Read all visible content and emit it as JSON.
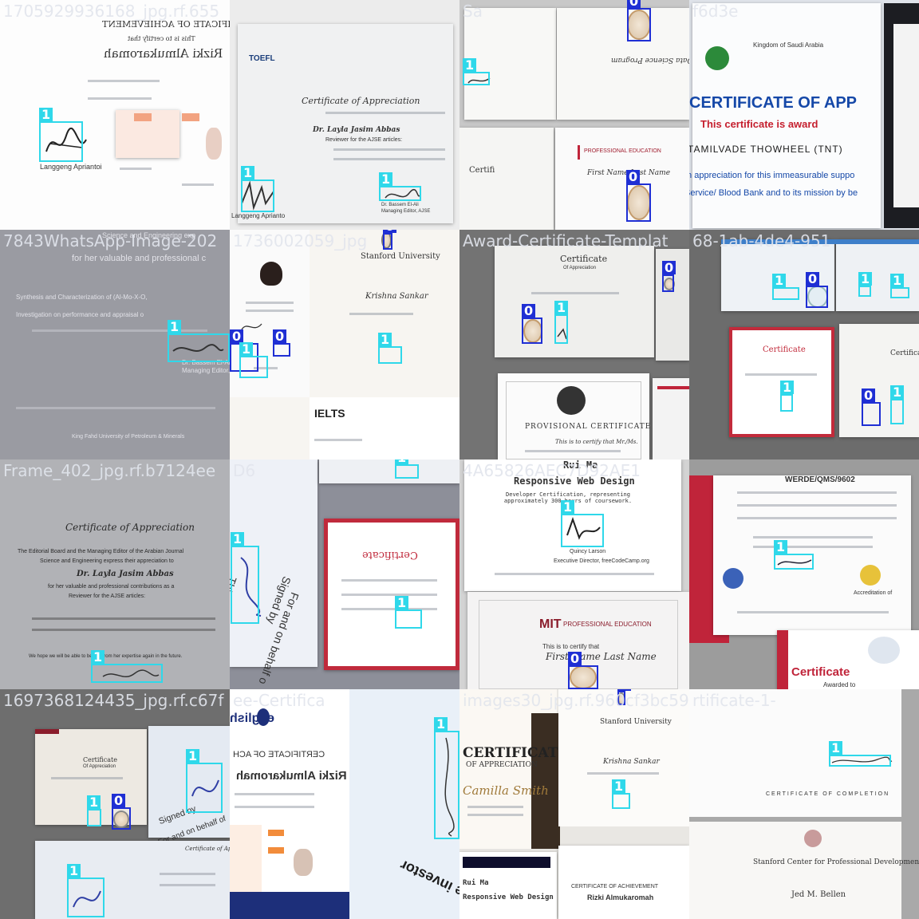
{
  "tiles": [
    {
      "label": "1705929936168_jpg.rf.655",
      "texts": {
        "t1": "CERTIFICATE OF ACHIEVEMENT",
        "t2": "This is to certify that",
        "t3": "Rizki Almukaromah",
        "t4": "Langgeng Apriantoi"
      }
    },
    {
      "label": "",
      "texts": {
        "t1": "Certificate of Appreciation",
        "t2": "Dr. Layla Jasim Abbas",
        "t3": "Reviewer for the AJSE articles:",
        "t4": "Langgeng Aprianto",
        "t5": "TOEFL",
        "t6": "Dr. Bassem El-Ali",
        "t7": "Managing Editor, AJSE"
      }
    },
    {
      "label": "Sa",
      "texts": {
        "t1": "PROFESSIONAL EDUCATION",
        "t2": "First Name Last Name",
        "t3": "Certifi"
      }
    },
    {
      "label": "f6d3e",
      "texts": {
        "t1": "Kingdom of Saudi Arabia",
        "t2": "CERTIFICATE OF APP",
        "t3": "This certificate is award",
        "t4": "TAMILVADE THOWHEEL (TNT)",
        "t5": "In appreciation for this immeasurable suppo",
        "t6": "Service/ Blood Bank and to its mission by be"
      }
    },
    {
      "label": "7843WhatsApp-Image-202",
      "texts": {
        "t1": "Science and Engineering exp",
        "t2": "for her valuable and professional c",
        "t3": "Synthesis and Characterization of (Al-Mo-X-O,",
        "t4": "Investigation on performance and appraisal o",
        "t5": "Dr. Bassem El-Al",
        "t6": "Managing Editor, A",
        "t7": "King Fahd University of Petroleum & Minerals"
      }
    },
    {
      "label": "1736002059_jpg",
      "texts": {
        "t1": "Stanford University",
        "t2": "Krishna Sankar",
        "t3": "IELTS"
      }
    },
    {
      "label": "Award-Certificate-Templat",
      "texts": {
        "t1": "Certificate",
        "t2": "Of Appreciation",
        "t3": "PROVISIONAL CERTIFICATE",
        "t4": "This is to certify that Mr./Ms."
      }
    },
    {
      "label": "68-1ab-4de4-951",
      "texts": {
        "t1": "Certificate",
        "t2": "Certificate"
      }
    },
    {
      "label": "Frame_402_jpg.rf.b7124ee",
      "texts": {
        "t1": "Certificate of Appreciation",
        "t2": "The Editorial Board and the Managing Editor of the Arabian Journal",
        "t3": "Science and Engineering express their appreciation to",
        "t4": "Dr. Layla Jasim Abbas",
        "t5": "for her valuable and professional contributions as a",
        "t6": "Reviewer for the AJSE articles:",
        "t7": "We hope we will be able to benefit from her expertise again in the future."
      }
    },
    {
      "label": "D6",
      "texts": {
        "t1": "Certificate",
        "t2": "This agreement",
        "t3": "Signed by",
        "t4": "For and on behalf o"
      }
    },
    {
      "label": "4A65826AEC7D92AE1",
      "texts": {
        "t1": "Responsive Web Design",
        "t2": "Developer Certification, representing approximately 300 hours of coursework.",
        "t3": "Quincy Larson",
        "t4": "Executive Director, freeCodeCamp.org",
        "t5": "PROFESSIONAL EDUCATION",
        "t6": "This is to certify that",
        "t7": "First Name Last Name",
        "t8": "Rui Ma"
      }
    },
    {
      "label": "",
      "texts": {
        "t1": "WERDE/QMS/9602",
        "t2": "Certificate",
        "t3": "Awarded to",
        "t4": "Accreditation of"
      }
    },
    {
      "label": "1697368124435_jpg.rf.c67f",
      "texts": {
        "t1": "Certificate",
        "t2": "Of Appreciation",
        "t3": "Signed by",
        "t4": "For and on behalf of",
        "t5": "Certificate of Appreciat"
      }
    },
    {
      "label": "ee-Certifica",
      "texts": {
        "t1": "english",
        "t2": "CERTIFICATE OF ACH",
        "t3": "Rizki Almukaromah",
        "t4": "the investor"
      }
    },
    {
      "label": "images30_jpg.rf.960cf3bc59",
      "texts": {
        "t1": "CERTIFICATE",
        "t2": "OF APPRECIATION",
        "t3": "Camilla Smith",
        "t4": "Stanford University",
        "t5": "Krishna Sankar",
        "t6": "Responsive Web Design",
        "t7": "CERTIFICATE OF ACHIEVEMENT",
        "t8": "Rizki Almukaromah",
        "t9": "Rui Ma"
      }
    },
    {
      "label": "rtificate-1-",
      "texts": {
        "t1": "CERTIFICATE OF COMPLETION",
        "t2": "Stanford Center for Professional Development",
        "t3": "Jed M. Bellen"
      }
    }
  ],
  "box_labels": {
    "signature": "1",
    "seal": "0"
  },
  "colors": {
    "signature_box": "#2fd8ea",
    "seal_box": "#1f2fd4"
  }
}
